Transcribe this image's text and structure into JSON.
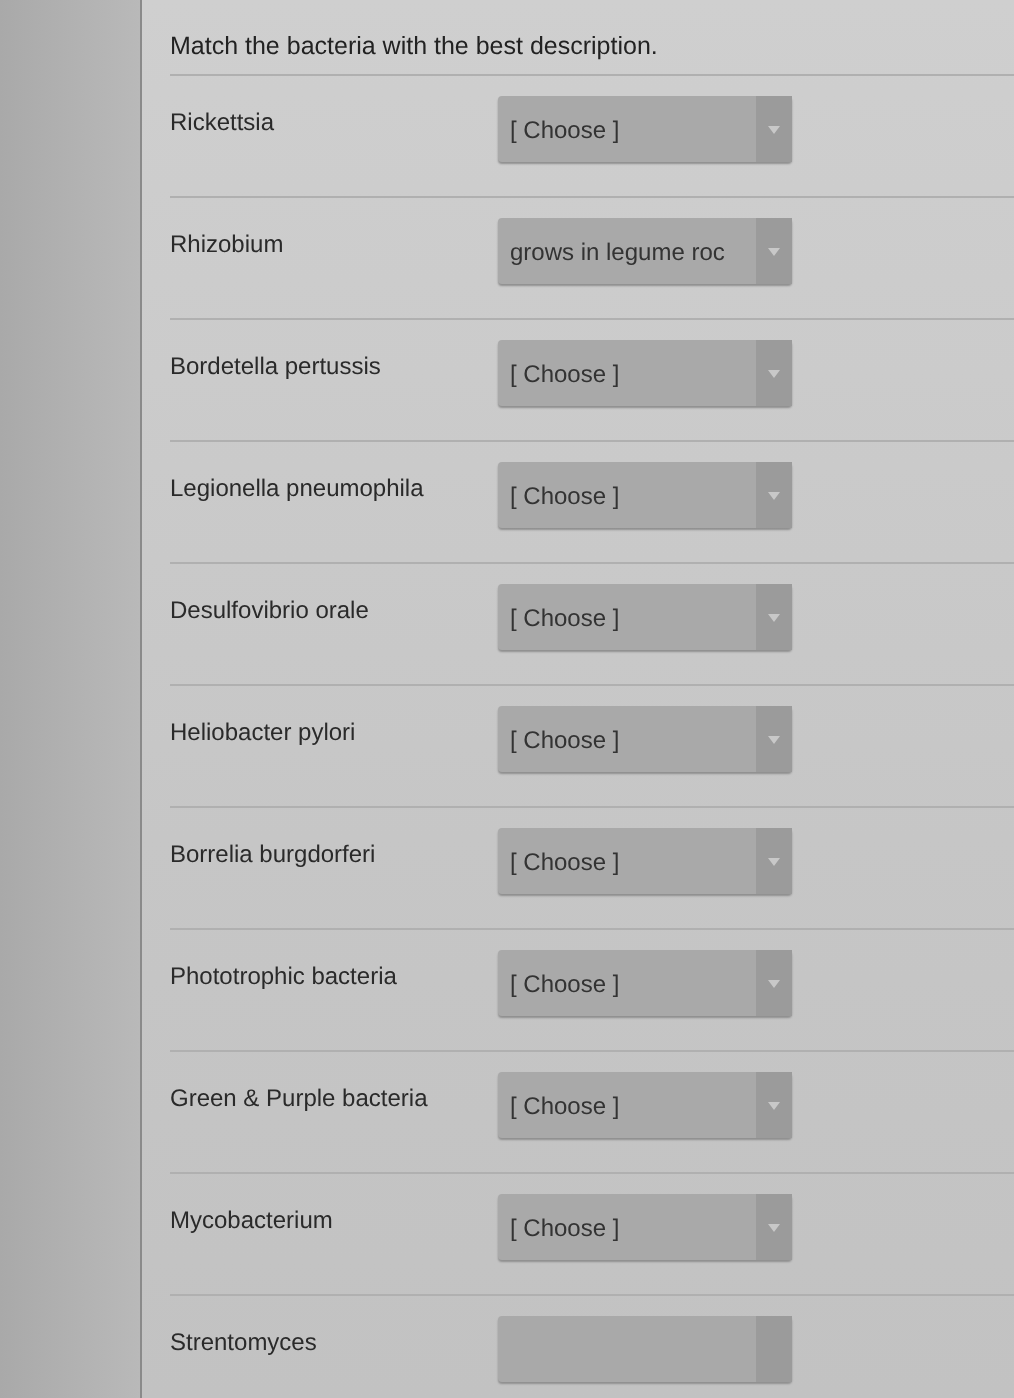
{
  "question": "Match the bacteria with the best description.",
  "rows": [
    {
      "label": "Rickettsia",
      "answer": "[ Choose ]"
    },
    {
      "label": "Rhizobium",
      "answer": "grows in legume roc"
    },
    {
      "label": "Bordetella pertussis",
      "answer": "[ Choose ]"
    },
    {
      "label": "Legionella pneumophila",
      "answer": "[ Choose ]"
    },
    {
      "label": "Desulfovibrio orale",
      "answer": "[ Choose ]"
    },
    {
      "label": "Heliobacter pylori",
      "answer": "[ Choose ]"
    },
    {
      "label": "Borrelia burgdorferi",
      "answer": "[ Choose ]"
    },
    {
      "label": "Phototrophic bacteria",
      "answer": "[ Choose ]"
    },
    {
      "label": "Green & Purple bacteria",
      "answer": "[ Choose ]"
    },
    {
      "label": "Mycobacterium",
      "answer": "[ Choose ]"
    },
    {
      "label": "Strentomyces"
    }
  ]
}
